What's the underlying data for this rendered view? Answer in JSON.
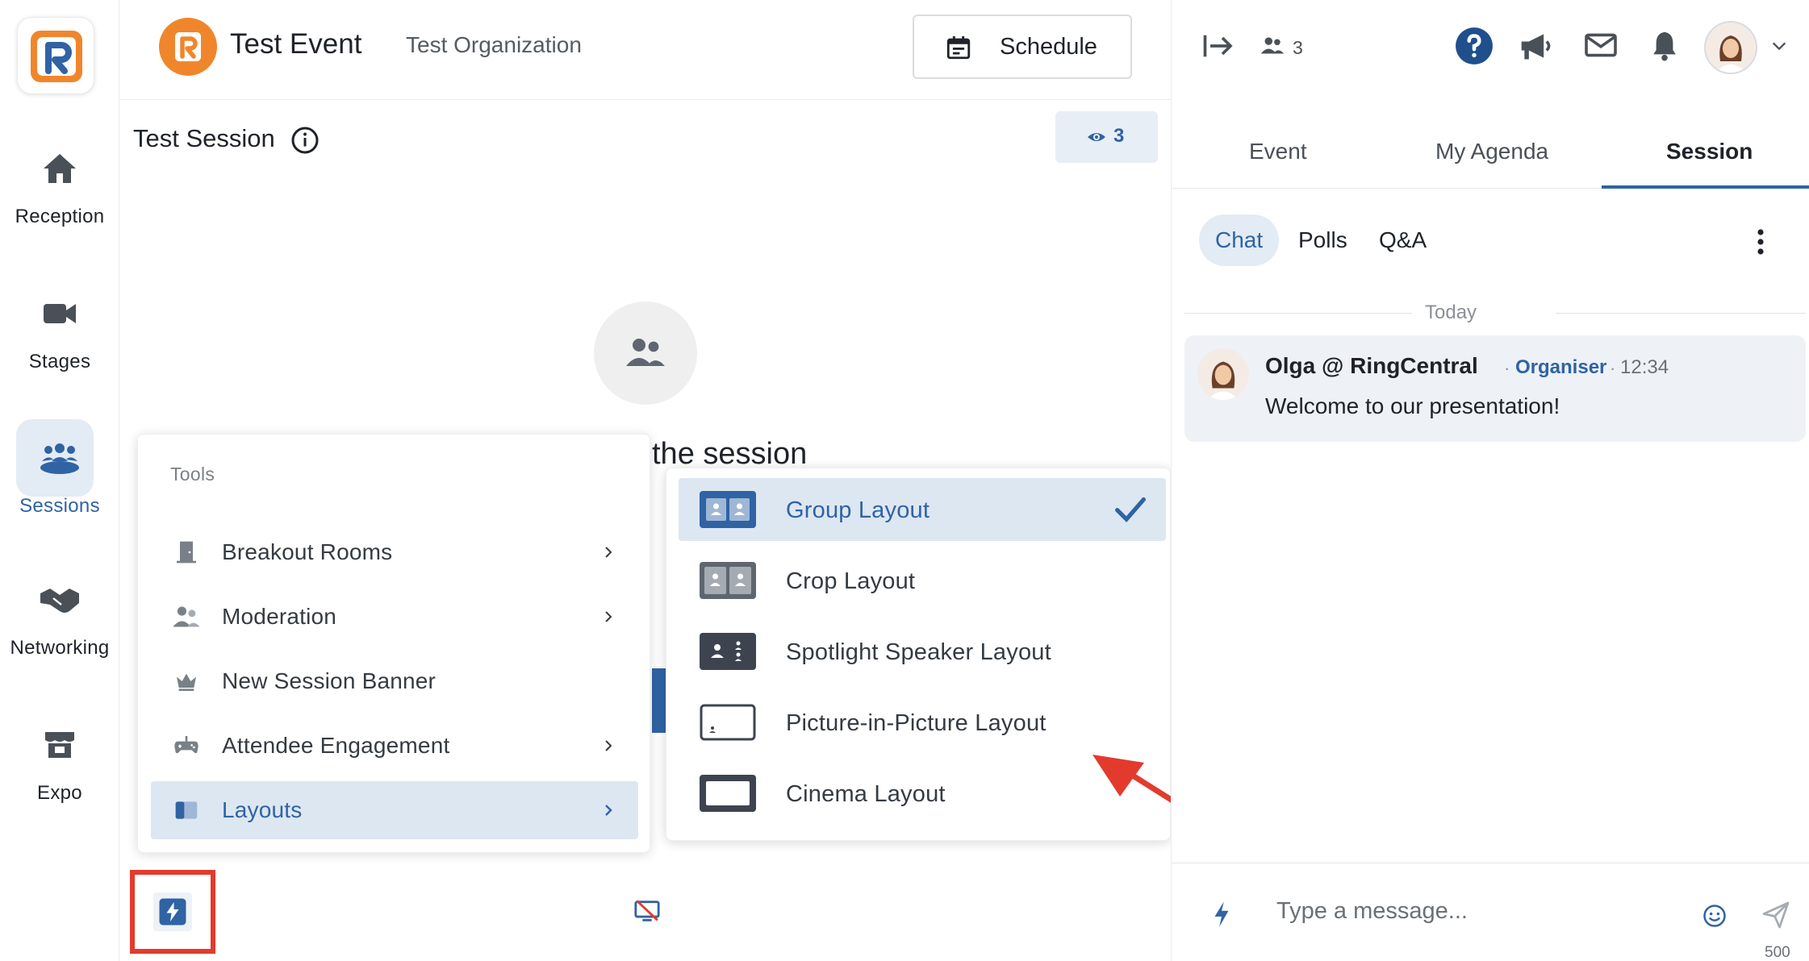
{
  "nav": {
    "items": [
      {
        "label": "Reception",
        "icon": "home-icon"
      },
      {
        "label": "Stages",
        "icon": "video-camera-icon"
      },
      {
        "label": "Sessions",
        "icon": "sessions-group-icon"
      },
      {
        "label": "Networking",
        "icon": "handshake-icon"
      },
      {
        "label": "Expo",
        "icon": "booth-icon"
      }
    ],
    "active": "Sessions"
  },
  "header": {
    "event_title": "Test Event",
    "organization": "Test Organization",
    "schedule_label": "Schedule"
  },
  "session": {
    "title": "Test Session",
    "viewer_count": "3",
    "waiting_text": "the session"
  },
  "tools_menu": {
    "header": "Tools",
    "items": [
      {
        "label": "Breakout Rooms",
        "icon": "door-icon",
        "has_submenu": true
      },
      {
        "label": "Moderation",
        "icon": "people-icon",
        "has_submenu": true
      },
      {
        "label": "New Session Banner",
        "icon": "crown-icon",
        "has_submenu": false
      },
      {
        "label": "Attendee Engagement",
        "icon": "gamepad-icon",
        "has_submenu": true
      },
      {
        "label": "Layouts",
        "icon": "layout-panel-icon",
        "has_submenu": true
      }
    ],
    "selected": "Layouts"
  },
  "layouts_menu": {
    "items": [
      {
        "label": "Group Layout",
        "icon": "group-layout-icon"
      },
      {
        "label": "Crop Layout",
        "icon": "crop-layout-icon"
      },
      {
        "label": "Spotlight Speaker Layout",
        "icon": "spotlight-layout-icon"
      },
      {
        "label": "Picture-in-Picture Layout",
        "icon": "pip-layout-icon"
      },
      {
        "label": "Cinema Layout",
        "icon": "cinema-layout-icon"
      }
    ],
    "selected": "Group Layout"
  },
  "right_panel": {
    "attendee_count": "3",
    "tabs": [
      "Event",
      "My Agenda",
      "Session"
    ],
    "active_tab": "Session",
    "subtabs": [
      "Chat",
      "Polls",
      "Q&A"
    ],
    "active_subtab": "Chat",
    "day_divider": "Today",
    "message": {
      "author": "Olga @ RingCentral",
      "role": "Organiser",
      "time": "12:34",
      "text": "Welcome to our presentation!"
    },
    "composer": {
      "placeholder": "Type a message...",
      "char_limit": "500"
    }
  },
  "colors": {
    "accent": "#2f63a4",
    "brand_orange": "#f0862c",
    "highlight_red": "#e23b2e",
    "selected_bg": "#dde7f2"
  }
}
